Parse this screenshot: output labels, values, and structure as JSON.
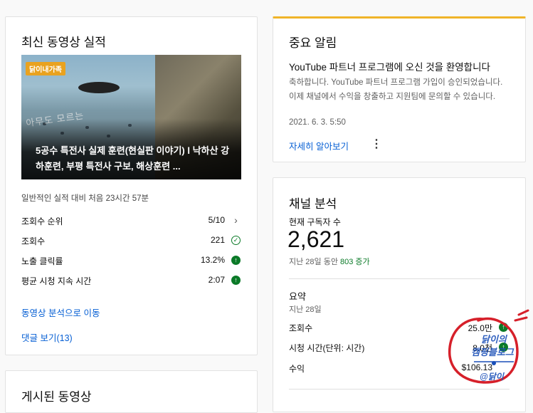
{
  "recent_video": {
    "title": "최신 동영상 실적",
    "thumbnail": {
      "badge": "닭이내가족",
      "overlay": "아무도 모르는",
      "video_title": "5공수 특전사 실제 훈련(현실판 이야기) l 낙하산 강하훈련, 부평 특전사 구보, 해상훈련 ..."
    },
    "first_note": "일반적인 실적 대비 처음 23시간 57분",
    "metrics": [
      {
        "label": "조회수 순위",
        "value": "5/10",
        "indicator": "chevron-right-icon"
      },
      {
        "label": "조회수",
        "value": "221",
        "indicator": "check-circle-icon"
      },
      {
        "label": "노출 클릭률",
        "value": "13.2%",
        "indicator": "arrow-up-icon"
      },
      {
        "label": "평균 시청 지속 시간",
        "value": "2:07",
        "indicator": "arrow-up-icon"
      }
    ],
    "analytics_link": "동영상 분석으로 이동",
    "comments_link": "댓글 보기(13)"
  },
  "published": {
    "title": "게시된 동영상"
  },
  "alert": {
    "title": "중요 알림",
    "headline": "YouTube 파트너 프로그램에 오신 것을 환영합니다",
    "body": "축하합니다. YouTube 파트너 프로그램 가입이 승인되었습니다. 이제 채널에서 수익을 창출하고 지원팀에 문의할 수 있습니다.",
    "date": "2021. 6. 3. 5:50",
    "more": "자세히 알아보기",
    "accent": "#f0b429"
  },
  "analytics": {
    "title": "채널 분석",
    "subs_label": "현재 구독자 수",
    "subs_value": "2,621",
    "subs_change_prefix": "지난 28일 동안",
    "subs_change_value": "803 증가",
    "summary_title": "요약",
    "summary_period": "지난 28일",
    "summary_rows": [
      {
        "label": "조회수",
        "value": "25.0만"
      },
      {
        "label": "시청 시간(단위: 시간)",
        "value": "8.0천"
      },
      {
        "label": "수익",
        "value": "$106.13"
      }
    ]
  },
  "watermark": {
    "line1": "닭이의",
    "line2": "캠핑블로그",
    "line3": "@닭이"
  },
  "colors": {
    "link": "#065fd4",
    "positive": "#0b7a28"
  }
}
